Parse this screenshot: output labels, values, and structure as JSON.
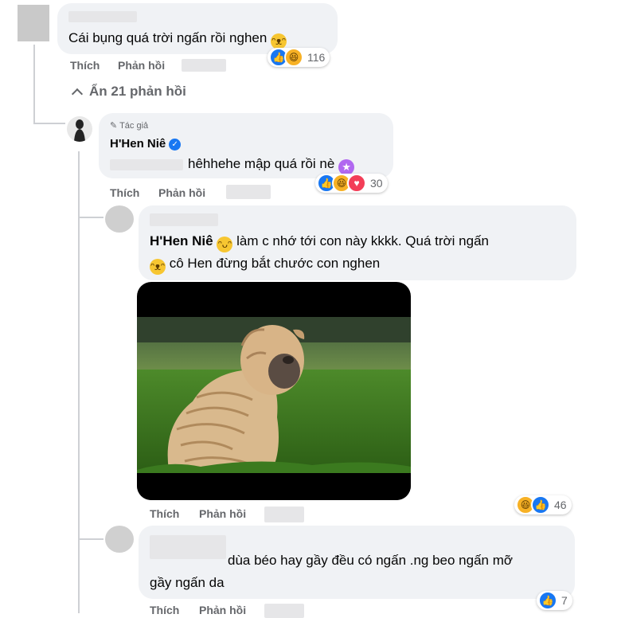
{
  "comments": [
    {
      "id": "c1",
      "text": "Cái bụng quá trời ngấn rồi nghen",
      "emoji": "😆",
      "actions": {
        "like": "Thích",
        "reply": "Phản hồi"
      },
      "reaction_icons": [
        "like-icon",
        "haha-icon"
      ],
      "reaction_count": "116"
    },
    {
      "id": "c2",
      "author_badge": "Tác giả",
      "author": "H'Hen Niê",
      "text": "hêhhehe mập quá rồi nè",
      "emoji": "🤩",
      "actions": {
        "like": "Thích",
        "reply": "Phản hồi"
      },
      "reaction_icons": [
        "like-icon",
        "haha-icon",
        "love-icon"
      ],
      "reaction_count": "30"
    },
    {
      "id": "c3",
      "mention": "H'Hen Niê",
      "text_line1": "làm c nhớ tới con này kkkk. Quá trời ngấn",
      "text_line2": "cô Hen đừng bắt chước con nghen",
      "actions": {
        "like": "Thích",
        "reply": "Phản hồi"
      },
      "reaction_icons": [
        "haha-icon",
        "like-icon"
      ],
      "reaction_count": "46"
    },
    {
      "id": "c4",
      "text_line1": "dùa béo hay gầy đều có ngấn .ng beo ngấn mỡ",
      "text_line2": "gầy ngấn da",
      "actions": {
        "like": "Thích",
        "reply": "Phản hồi"
      },
      "reaction_icons": [
        "like-icon"
      ],
      "reaction_count": "7"
    }
  ],
  "hide_replies": "Ẩn 21 phản hồi",
  "colors": {
    "bubble": "#f0f2f5",
    "secondary_text": "#65676b",
    "like_blue": "#1877f2",
    "haha_yellow": "#f7b125",
    "love_red": "#f33e58"
  }
}
